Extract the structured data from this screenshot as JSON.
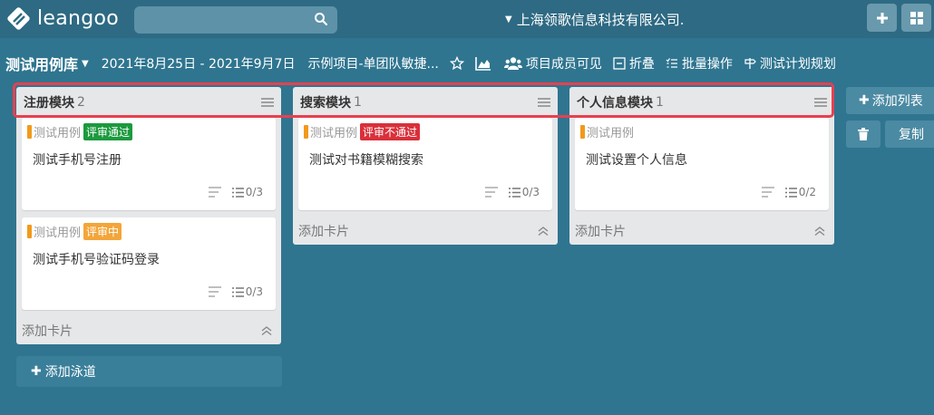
{
  "app": {
    "logo_text": "leangoo"
  },
  "topbar": {
    "org_name": "上海领歌信息科技有限公司."
  },
  "board": {
    "title": "测试用例库",
    "date_range": "2021年8月25日 - 2021年9月7日",
    "project": "示例项目-单团队敏捷...",
    "visibility": "项目成员可见",
    "collapse_label": "折叠",
    "batch_label": "批量操作",
    "plan_label": "测试计划规划"
  },
  "colors": {
    "badge_pass": "#1b9a3e",
    "badge_fail": "#d9303a",
    "badge_review": "#f3a53a",
    "card_flag": "#f19a1b",
    "highlight": "#e8404f"
  },
  "lists": [
    {
      "title": "注册模块",
      "count": "2",
      "cards": [
        {
          "type": "测试用例",
          "badge": "评审通过",
          "title": "测试手机号注册",
          "checklist": "0/3"
        },
        {
          "type": "测试用例",
          "badge": "评审中",
          "title": "测试手机号验证码登录",
          "checklist": "0/3"
        }
      ],
      "add_card": "添加卡片"
    },
    {
      "title": "搜索模块",
      "count": "1",
      "cards": [
        {
          "type": "测试用例",
          "badge": "评审不通过",
          "title": "测试对书籍模糊搜索",
          "checklist": "0/3"
        }
      ],
      "add_card": "添加卡片"
    },
    {
      "title": "个人信息模块",
      "count": "1",
      "cards": [
        {
          "type": "测试用例",
          "badge": "",
          "title": "测试设置个人信息",
          "checklist": "0/2"
        }
      ],
      "add_card": "添加卡片"
    }
  ],
  "add_lane": "添加泳道",
  "side": {
    "add_list": "添加列表",
    "copy": "复制"
  }
}
